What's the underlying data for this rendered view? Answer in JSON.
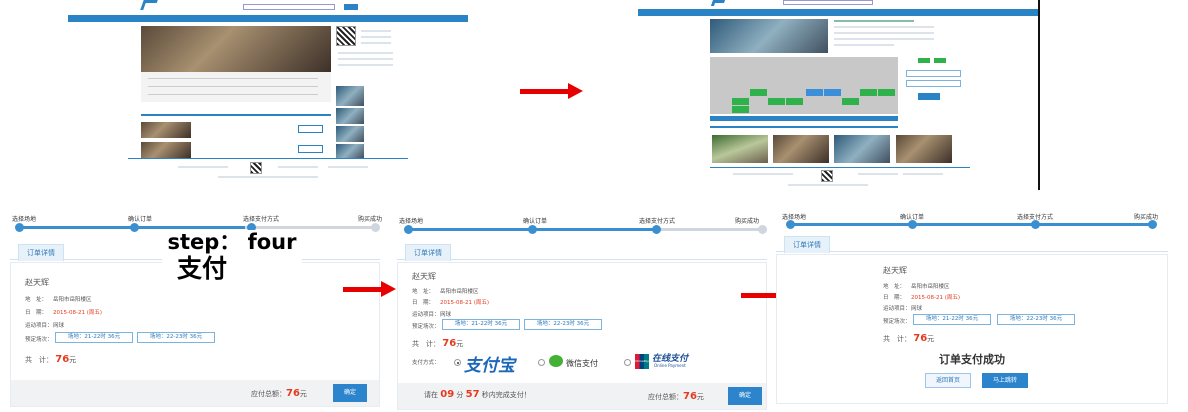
{
  "headline": {
    "step": "step： four",
    "sub": "支付"
  },
  "steps": [
    "选择场地",
    "确认订单",
    "选择支付方式",
    "购买成功"
  ],
  "order": {
    "tab": "订单详情",
    "name": "赵天辉",
    "address_label": "地　址：",
    "address": "岳阳市岳阳楼区",
    "date_label": "日　期：",
    "date": "2015-08-21 (周五)",
    "sport_label": "运动项目：",
    "sport": "网球",
    "slots_label": "预定场次：",
    "slot1": "场地：21-22时 36元",
    "slot2": "场地：22-23时 36元",
    "total_label": "共　计：",
    "total_value": "76",
    "total_unit": "元"
  },
  "panel1": {
    "due_label": "应付总额：",
    "due_value": "76",
    "due_unit": "元",
    "confirm": "确定"
  },
  "panel2": {
    "pay_label": "支付方式：",
    "alipay": "支付宝",
    "wechat": "微信支付",
    "unionpay_cn": "在线支付",
    "unionpay_en": "Online Payment",
    "unionpay_badge": "ChinaPay",
    "timer_pre": "请在",
    "timer_min": "09",
    "timer_min_unit": "分",
    "timer_sec": "57",
    "timer_post": "秒内完成支付！",
    "due_label": "应付总额：",
    "due_value": "76",
    "due_unit": "元",
    "confirm": "确定"
  },
  "panel3": {
    "success": "订单支付成功",
    "back": "返回首页",
    "jump": "马上跳转"
  },
  "colors": {
    "accent": "#2b84cc",
    "price": "#e53a1f",
    "arrow": "#e60000"
  }
}
